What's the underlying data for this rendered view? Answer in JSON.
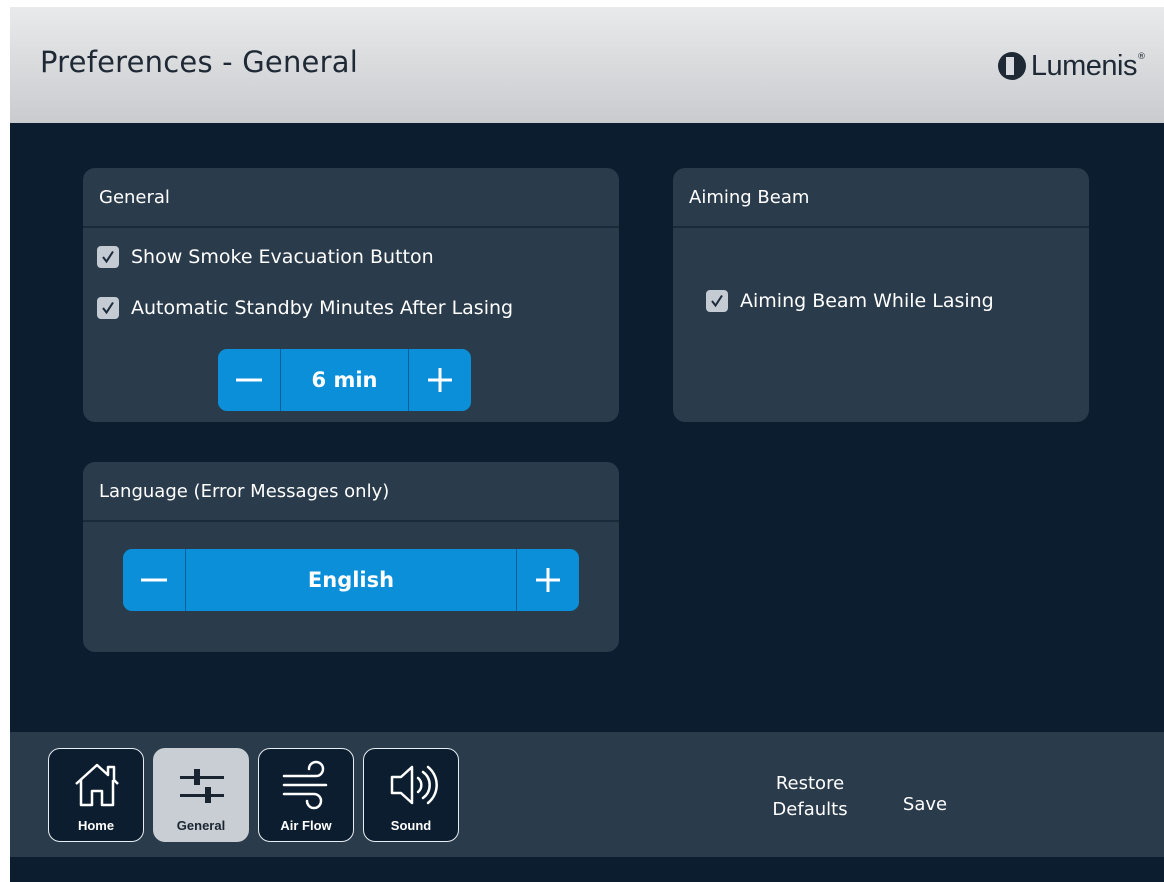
{
  "header": {
    "title": "Preferences - General",
    "logo_text": "Lumenis",
    "logo_reg": "®"
  },
  "general_panel": {
    "title": "General",
    "options": [
      {
        "label": "Show Smoke Evacuation Button",
        "checked": true
      },
      {
        "label": "Automatic Standby Minutes After Lasing",
        "checked": true
      }
    ],
    "standby_stepper": {
      "minus": "−",
      "value": "6 min",
      "plus": "+"
    }
  },
  "aiming_panel": {
    "title": "Aiming Beam",
    "option": {
      "label": "Aiming Beam While Lasing",
      "checked": true
    }
  },
  "language_panel": {
    "title": "Language (Error Messages only)",
    "stepper": {
      "minus": "−",
      "value": "English",
      "plus": "+"
    }
  },
  "footer": {
    "nav": [
      {
        "label": "Home",
        "icon": "home-icon",
        "active": false
      },
      {
        "label": "General",
        "icon": "sliders-icon",
        "active": true
      },
      {
        "label": "Air Flow",
        "icon": "wind-icon",
        "active": false
      },
      {
        "label": "Sound",
        "icon": "speaker-icon",
        "active": false
      }
    ],
    "restore_line1": "Restore",
    "restore_line2": "Defaults",
    "save": "Save"
  },
  "colors": {
    "background": "#0b1d2e",
    "panel": "#2a3b4b",
    "accent_blue": "#0a8fd8",
    "checkbox": "#c4cbd2"
  }
}
